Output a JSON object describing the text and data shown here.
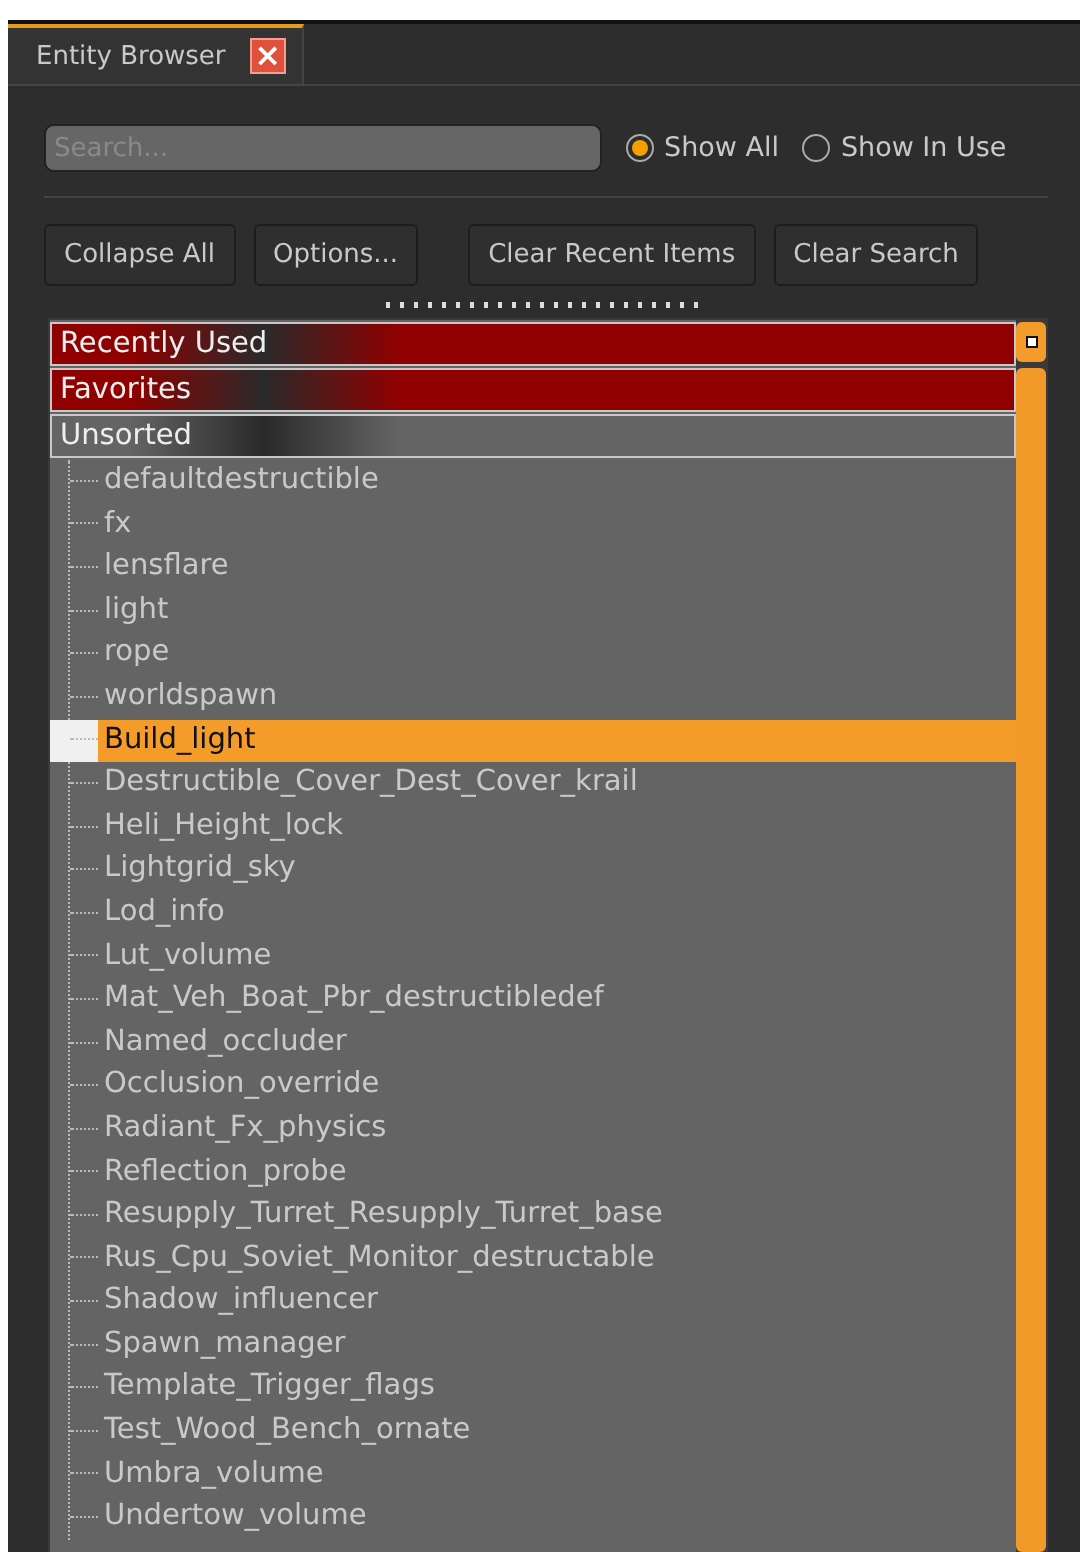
{
  "tab": {
    "title": "Entity Browser",
    "close": "×"
  },
  "search": {
    "placeholder": "Search..."
  },
  "filters": [
    {
      "label": "Show All",
      "selected": true
    },
    {
      "label": "Show In Use",
      "selected": false
    }
  ],
  "buttons": [
    "Collapse All",
    "Options...",
    "Clear Recent Items",
    "Clear Search"
  ],
  "tree": [
    {
      "label": "Recently Used",
      "color": "#8f0000"
    },
    {
      "label": "Favorites",
      "color": "#8f0000"
    },
    {
      "label": "Unsorted",
      "color": "#646464",
      "children": [
        {
          "label": "defaultdestructible",
          "selected": false
        },
        {
          "label": "fx",
          "selected": false
        },
        {
          "label": "lensflare",
          "selected": false
        },
        {
          "label": "light",
          "selected": false
        },
        {
          "label": "rope",
          "selected": false
        },
        {
          "label": "worldspawn",
          "selected": false
        },
        {
          "label": "Build_light",
          "selected": true
        },
        {
          "label": "Destructible_Cover_Dest_Cover_krail",
          "selected": false
        },
        {
          "label": "Heli_Height_lock",
          "selected": false
        },
        {
          "label": "Lightgrid_sky",
          "selected": false
        },
        {
          "label": "Lod_info",
          "selected": false
        },
        {
          "label": "Lut_volume",
          "selected": false
        },
        {
          "label": "Mat_Veh_Boat_Pbr_destructibledef",
          "selected": false
        },
        {
          "label": "Named_occluder",
          "selected": false
        },
        {
          "label": "Occlusion_override",
          "selected": false
        },
        {
          "label": "Radiant_Fx_physics",
          "selected": false
        },
        {
          "label": "Reflection_probe",
          "selected": false
        },
        {
          "label": "Resupply_Turret_Resupply_Turret_base",
          "selected": false
        },
        {
          "label": "Rus_Cpu_Soviet_Monitor_destructable",
          "selected": false
        },
        {
          "label": "Shadow_influencer",
          "selected": false
        },
        {
          "label": "Spawn_manager",
          "selected": false
        },
        {
          "label": "Template_Trigger_flags",
          "selected": false
        },
        {
          "label": "Test_Wood_Bench_ornate",
          "selected": false
        },
        {
          "label": "Umbra_volume",
          "selected": false
        },
        {
          "label": "Undertow_volume",
          "selected": false
        }
      ]
    }
  ]
}
